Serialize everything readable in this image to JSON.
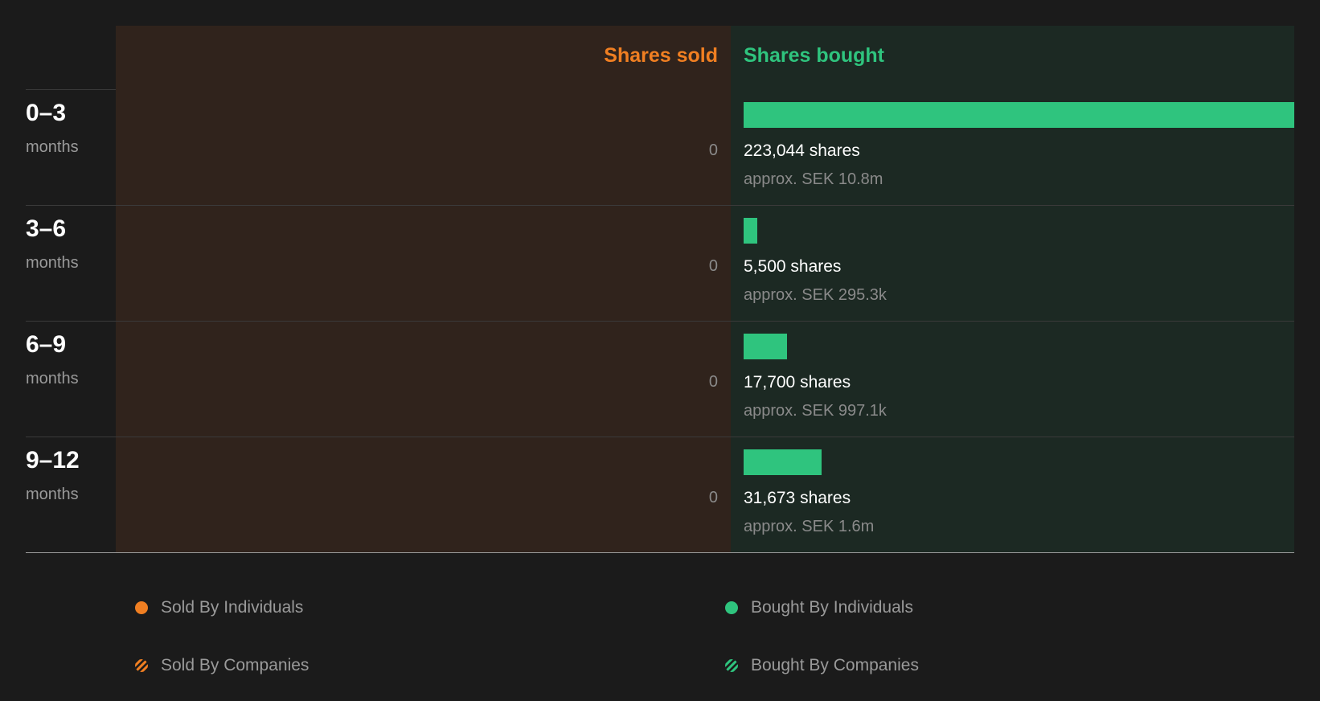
{
  "colors": {
    "sold": "#f07f22",
    "bought": "#2fc47e"
  },
  "chart_data": {
    "type": "bar",
    "title": "",
    "columns": {
      "sold": "Shares sold",
      "bought": "Shares bought"
    },
    "categories": [
      {
        "range": "0–3",
        "unit": "months"
      },
      {
        "range": "3–6",
        "unit": "months"
      },
      {
        "range": "6–9",
        "unit": "months"
      },
      {
        "range": "9–12",
        "unit": "months"
      }
    ],
    "series": [
      {
        "name": "Shares sold",
        "values": [
          0,
          0,
          0,
          0
        ],
        "labels": [
          "0",
          "0",
          "0",
          "0"
        ]
      },
      {
        "name": "Shares bought",
        "values": [
          223044,
          5500,
          17700,
          31673
        ],
        "labels": [
          "223,044 shares",
          "5,500 shares",
          "17,700 shares",
          "31,673 shares"
        ],
        "approx": [
          "approx. SEK 10.8m",
          "approx. SEK 295.3k",
          "approx. SEK 997.1k",
          "approx. SEK 1.6m"
        ]
      }
    ],
    "legend": [
      {
        "label": "Sold By Individuals",
        "icon": "orange-dot-icon"
      },
      {
        "label": "Bought By Individuals",
        "icon": "green-dot-icon"
      },
      {
        "label": "Sold By Companies",
        "icon": "orange-hatched-dot-icon"
      },
      {
        "label": "Bought By Companies",
        "icon": "green-hatched-dot-icon"
      }
    ]
  }
}
